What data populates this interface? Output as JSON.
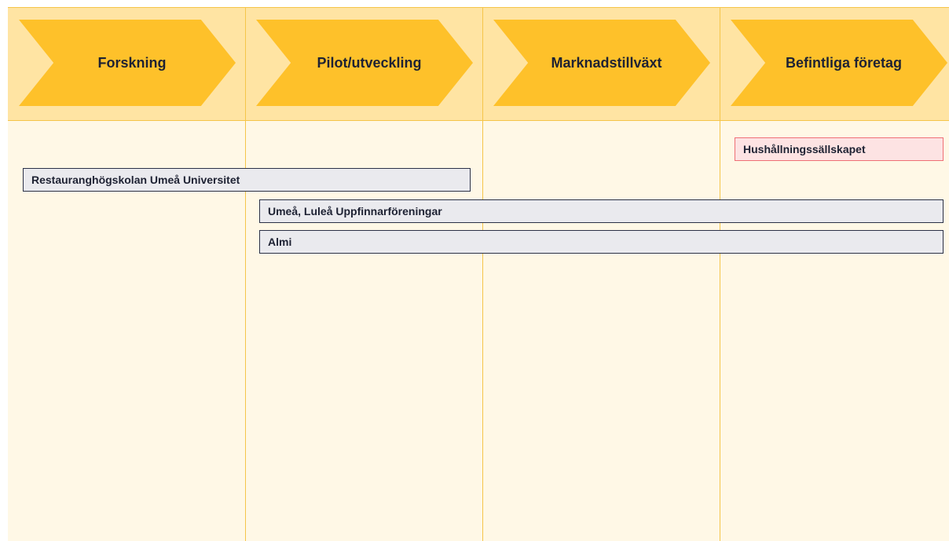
{
  "stages": [
    {
      "label": "Forskning"
    },
    {
      "label": "Pilot/utveckling"
    },
    {
      "label": "Marknadstillväxt"
    },
    {
      "label": "Befintliga företag"
    }
  ],
  "actors": [
    {
      "label": "Hushållningssällskapet",
      "color": "#fde3e3",
      "border": "#ef6f76"
    },
    {
      "label": "Restauranghögskolan Umeå Universitet",
      "color": "#eaeaee",
      "border": "#2b3147"
    },
    {
      "label": "Umeå, Luleå Uppfinnarföreningar",
      "color": "#eaeaee",
      "border": "#2b3147"
    },
    {
      "label": "Almi",
      "color": "#eaeaee",
      "border": "#2b3147"
    }
  ],
  "colors": {
    "chevron": "#fec12a",
    "header_band": "#ffe4a3",
    "board": "#fff8e6",
    "grid_line": "#f5c54a"
  }
}
